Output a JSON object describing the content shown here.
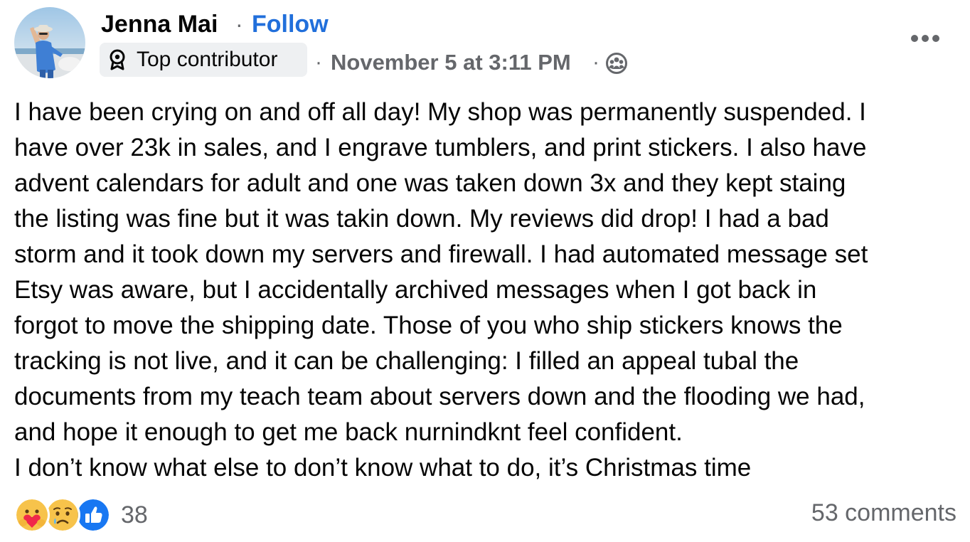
{
  "post": {
    "author": {
      "name": "Jenna Mai",
      "separator": "·",
      "follow_label": "Follow",
      "badge_label": "Top contributor",
      "badge_icon": "contributor-badge-icon"
    },
    "meta": {
      "dot": "·",
      "timestamp": "November 5 at 3:11 PM",
      "audience_icon": "group-audience-icon"
    },
    "more_icon": "more-options-icon",
    "body_lines": [
      "I have been crying on and off all day! My shop was permanently suspended. I",
      "have over 23k in sales, and I engrave tumblers, and print stickers. I also have",
      "advent calendars for adult and one was taken down 3x and they kept staing",
      "the listing was fine but it was takin down. My reviews did drop! I had a bad",
      "storm and it took down my servers and firewall. I had automated message set",
      "Etsy was aware, but I accidentally archived messages when I got back in",
      "forgot to move the shipping date. Those of you who ship stickers knows the",
      "tracking is not live, and it can be challenging: I filled an appeal tubal the",
      "documents from my teach team about servers down and the flooding we had,",
      "and hope it enough to get me back nurnindknt feel confident.",
      "I don’t know what else to don’t know what to do, it’s Christmas time"
    ],
    "reactions": {
      "types": [
        "care",
        "sad",
        "like"
      ],
      "count": "38"
    },
    "comments_label": "53 comments"
  },
  "colors": {
    "text": "#050505",
    "secondary_text": "#65676b",
    "link_blue": "#216fdb",
    "badge_bg": "#eef0f2",
    "like_blue": "#1877f2",
    "reaction_yellow": "#f7c34b",
    "care_heart_red": "#f0284a"
  }
}
